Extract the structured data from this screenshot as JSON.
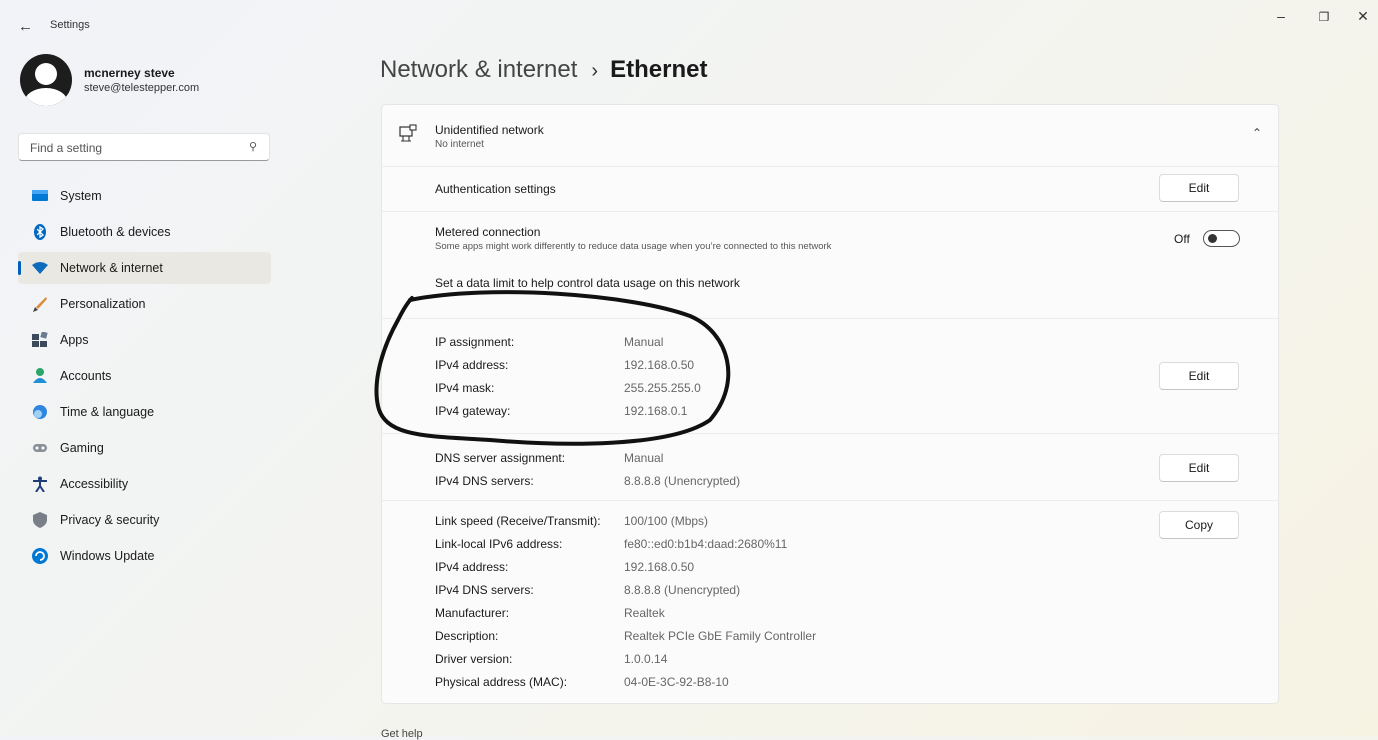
{
  "window": {
    "back": "←",
    "title": "Settings",
    "minimize": "–",
    "restore": "❐",
    "close": "✕"
  },
  "profile": {
    "name": "mcnerney steve",
    "email": "steve@telestepper.com"
  },
  "search": {
    "placeholder": "Find a setting",
    "icon": "search-icon"
  },
  "nav": [
    {
      "label": "System",
      "icon": "system-icon",
      "color": "#0078d4"
    },
    {
      "label": "Bluetooth & devices",
      "icon": "bluetooth-icon",
      "color": "#0067c0"
    },
    {
      "label": "Network & internet",
      "icon": "wifi-icon",
      "color": "#0f6cbd",
      "active": true
    },
    {
      "label": "Personalization",
      "icon": "brush-icon",
      "color": "#d98a3a"
    },
    {
      "label": "Apps",
      "icon": "apps-icon",
      "color": "#3d4a5c"
    },
    {
      "label": "Accounts",
      "icon": "accounts-icon",
      "color": "#2aa66a"
    },
    {
      "label": "Time & language",
      "icon": "globe-clock-icon",
      "color": "#2e86de"
    },
    {
      "label": "Gaming",
      "icon": "gamepad-icon",
      "color": "#8a9099"
    },
    {
      "label": "Accessibility",
      "icon": "accessibility-icon",
      "color": "#1f3d7a"
    },
    {
      "label": "Privacy & security",
      "icon": "shield-icon",
      "color": "#7a7f87"
    },
    {
      "label": "Windows Update",
      "icon": "update-icon",
      "color": "#0078d4"
    }
  ],
  "breadcrumb": {
    "parent": "Network & internet",
    "separator": "›",
    "current": "Ethernet"
  },
  "network": {
    "name": "Unidentified network",
    "status": "No internet",
    "collapse": "⌃"
  },
  "auth": {
    "label": "Authentication settings",
    "button": "Edit"
  },
  "metered": {
    "title": "Metered connection",
    "desc": "Some apps might work differently to reduce data usage when you’re connected to this network",
    "state": "Off",
    "on": false,
    "limit_link": "Set a data limit to help control data usage on this network"
  },
  "ip": {
    "button": "Edit",
    "rows": [
      {
        "label": "IP assignment:",
        "value": "Manual"
      },
      {
        "label": "IPv4 address:",
        "value": "192.168.0.50"
      },
      {
        "label": "IPv4 mask:",
        "value": "255.255.255.0"
      },
      {
        "label": "IPv4 gateway:",
        "value": "192.168.0.1"
      }
    ]
  },
  "dns": {
    "button": "Edit",
    "rows": [
      {
        "label": "DNS server assignment:",
        "value": "Manual"
      },
      {
        "label": "IPv4 DNS servers:",
        "value": "8.8.8.8 (Unencrypted)"
      }
    ]
  },
  "props": {
    "button": "Copy",
    "rows": [
      {
        "label": "Link speed (Receive/Transmit):",
        "value": "100/100 (Mbps)"
      },
      {
        "label": "Link-local IPv6 address:",
        "value": "fe80::ed0:b1b4:daad:2680%11"
      },
      {
        "label": "IPv4 address:",
        "value": "192.168.0.50"
      },
      {
        "label": "IPv4 DNS servers:",
        "value": "8.8.8.8 (Unencrypted)"
      },
      {
        "label": "Manufacturer:",
        "value": "Realtek"
      },
      {
        "label": "Description:",
        "value": "Realtek PCIe GbE Family Controller"
      },
      {
        "label": "Driver version:",
        "value": "1.0.0.14"
      },
      {
        "label": "Physical address (MAC):",
        "value": "04-0E-3C-92-B8-10"
      }
    ]
  },
  "footer": {
    "text": "Get help"
  }
}
